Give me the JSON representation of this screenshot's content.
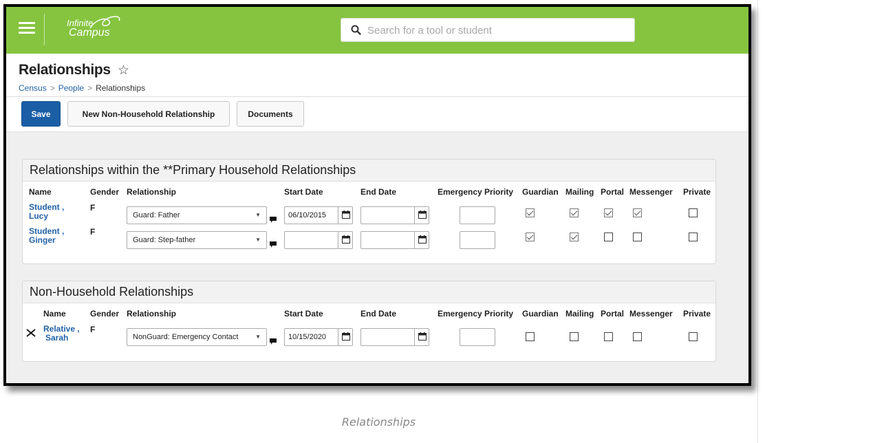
{
  "app": {
    "logo_line1": "Infinite",
    "logo_line2": "Campus",
    "search_placeholder": "Search for a tool or student",
    "accent_color": "#86c440",
    "primary_button_color": "#1b5ea6",
    "link_color": "#2262a8"
  },
  "page": {
    "title": "Relationships",
    "breadcrumb": [
      "Census",
      "People",
      "Relationships"
    ]
  },
  "toolbar": {
    "save_label": "Save",
    "new_relationship_label": "New Non-Household Relationship",
    "documents_label": "Documents"
  },
  "columns": {
    "name": "Name",
    "gender": "Gender",
    "relationship": "Relationship",
    "start_date": "Start Date",
    "end_date": "End Date",
    "emergency_priority": "Emergency Priority",
    "guardian": "Guardian",
    "mailing": "Mailing",
    "portal": "Portal",
    "messenger": "Messenger",
    "private": "Private"
  },
  "household": {
    "heading": "Relationships within the **Primary Household Relationships",
    "rows": [
      {
        "name_line1": "Student ,",
        "name_line2": "Lucy",
        "gender": "F",
        "relationship": "Guard: Father",
        "start_date": "06/10/2015",
        "end_date": "",
        "emergency_priority": "",
        "guardian": true,
        "mailing": true,
        "portal": true,
        "messenger": true,
        "private": false
      },
      {
        "name_line1": "Student ,",
        "name_line2": "Ginger",
        "gender": "F",
        "relationship": "Guard: Step-father",
        "start_date": "",
        "end_date": "",
        "emergency_priority": "",
        "guardian": true,
        "mailing": true,
        "portal": false,
        "messenger": false,
        "private": false
      }
    ]
  },
  "non_household": {
    "heading": "Non-Household Relationships",
    "rows": [
      {
        "name_line1": "Relative ,",
        "name_line2": "Sarah",
        "gender": "F",
        "relationship": "NonGuard: Emergency Contact",
        "start_date": "10/15/2020",
        "end_date": "",
        "emergency_priority": "",
        "guardian": false,
        "mailing": false,
        "portal": false,
        "messenger": false,
        "private": false
      }
    ]
  },
  "caption": "Relationships"
}
